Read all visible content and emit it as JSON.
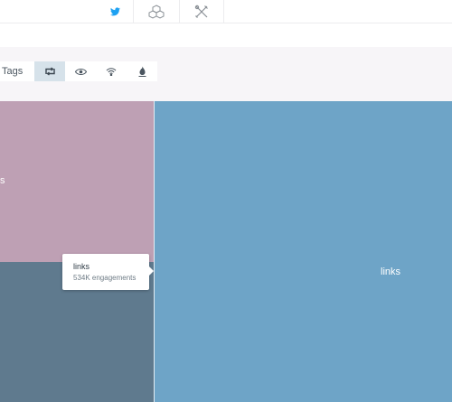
{
  "topbar": {
    "icons": [
      "twitter-bird-icon",
      "cubes-icon",
      "tools-icon"
    ],
    "accent": "#1da1f2"
  },
  "toolbar": {
    "tags_label": "Tags",
    "icons": [
      "retweet-icon",
      "eye-icon",
      "wifi-icon",
      "flame-icon"
    ],
    "active_icon": "retweet-icon"
  },
  "treemap": {
    "tiles": [
      {
        "label": "s",
        "color": "#bea0b4"
      },
      {
        "label": "",
        "color": "#5f7a8e"
      },
      {
        "label": "links",
        "color": "#6ea4c7"
      }
    ]
  },
  "tooltip": {
    "title": "links",
    "subtitle": "534K engagements"
  }
}
